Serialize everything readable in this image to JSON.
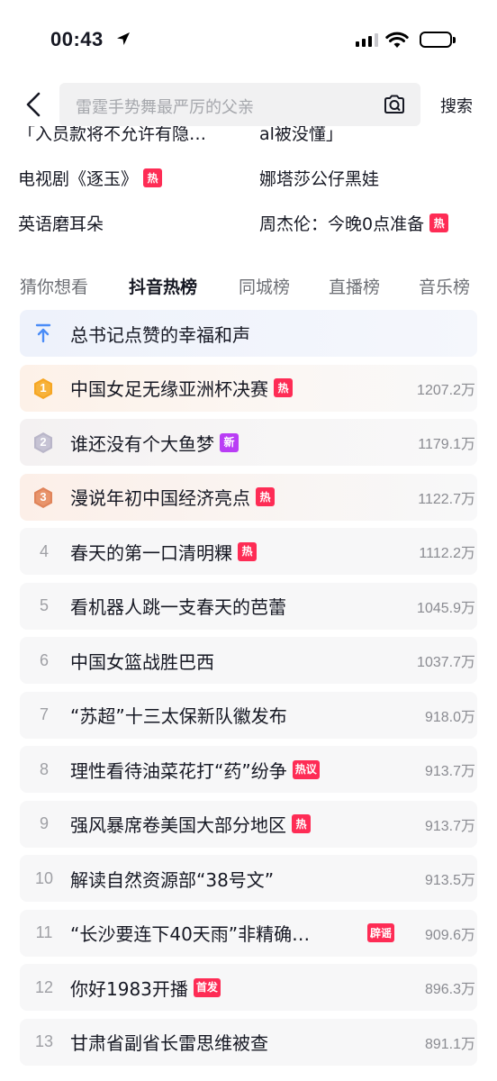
{
  "status_bar": {
    "time": "00:43"
  },
  "search": {
    "placeholder": "雷霆手势舞最严厉的父亲",
    "button": "搜索"
  },
  "suggestions": {
    "cut_left": "「入员款将不允许有隐…",
    "cut_right": "al被没懂」",
    "items": [
      {
        "label": "电视剧《逐玉》",
        "tag": "热"
      },
      {
        "label": "娜塔莎公仔黑娃",
        "tag": ""
      },
      {
        "label": "英语磨耳朵",
        "tag": ""
      },
      {
        "label": "周杰伦：今晚0点准备",
        "tag": "热"
      }
    ]
  },
  "tabs": [
    "猜你想看",
    "抖音热榜",
    "同城榜",
    "直播榜",
    "音乐榜"
  ],
  "active_tab": "抖音热榜",
  "pinned": {
    "title": "总书记点赞的幸福和声"
  },
  "ranking": [
    {
      "rank": "1",
      "title": "中国女足无缘亚洲杯决赛",
      "tag": "热",
      "heat": "1207.2万"
    },
    {
      "rank": "2",
      "title": "谁还没有个大鱼梦",
      "tag": "新",
      "heat": "1179.1万"
    },
    {
      "rank": "3",
      "title": "漫说年初中国经济亮点",
      "tag": "热",
      "heat": "1122.7万"
    },
    {
      "rank": "4",
      "title": "春天的第一口清明粿",
      "tag": "热",
      "heat": "1112.2万"
    },
    {
      "rank": "5",
      "title": "看机器人跳一支春天的芭蕾",
      "tag": "",
      "heat": "1045.9万"
    },
    {
      "rank": "6",
      "title": "中国女篮战胜巴西",
      "tag": "",
      "heat": "1037.7万"
    },
    {
      "rank": "7",
      "title": "“苏超”十三太保新队徽发布",
      "tag": "",
      "heat": "918.0万"
    },
    {
      "rank": "8",
      "title": "理性看待油菜花打“药”纷争",
      "tag": "热议",
      "heat": "913.7万"
    },
    {
      "rank": "9",
      "title": "强风暴席卷美国大部分地区",
      "tag": "热",
      "heat": "913.7万"
    },
    {
      "rank": "10",
      "title": "解读自然资源部“38号文”",
      "tag": "",
      "heat": "913.5万"
    },
    {
      "rank": "11",
      "title": "“长沙要连下40天雨”非精确…",
      "tag": "辟谣",
      "heat": "909.6万"
    },
    {
      "rank": "12",
      "title": "你好1983开播",
      "tag": "首发",
      "heat": "896.3万"
    },
    {
      "rank": "13",
      "title": "甘肃省副省长雷思维被查",
      "tag": "",
      "heat": "891.1万"
    }
  ],
  "colors": {
    "hot_tag": "#fe2c55",
    "new_tag": "#b93df5",
    "gold": "#f6a623",
    "silver": "#b9b6c9",
    "bronze": "#e0845a",
    "pin": "#4a8cf7"
  }
}
